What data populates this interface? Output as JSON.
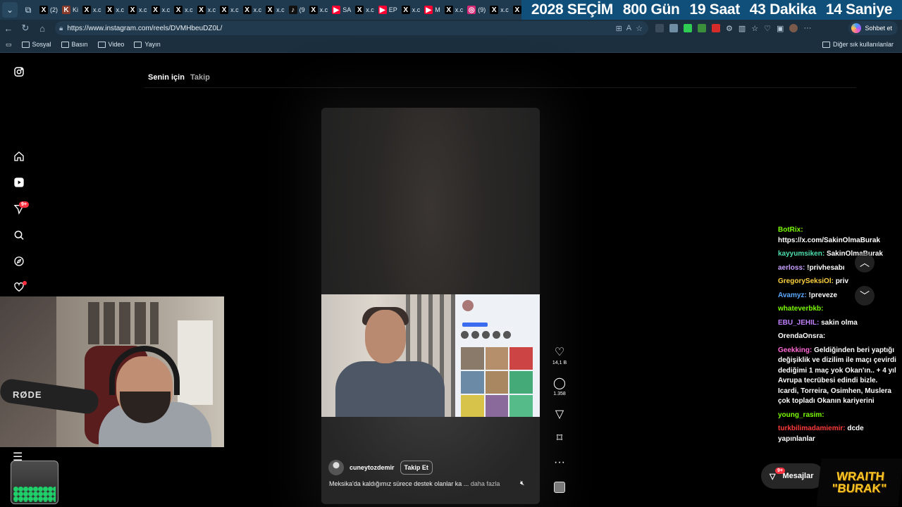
{
  "browser": {
    "tabs": [
      {
        "icon": "x-icon",
        "label": "(2)"
      },
      {
        "icon": "ki-icon",
        "label": "Ki"
      },
      {
        "icon": "x-icon",
        "label": "x.c"
      },
      {
        "icon": "x-icon",
        "label": "x.c"
      },
      {
        "icon": "x-icon",
        "label": "x.c"
      },
      {
        "icon": "x-icon",
        "label": "x.c"
      },
      {
        "icon": "x-icon",
        "label": "x.c"
      },
      {
        "icon": "x-icon",
        "label": "x.c"
      },
      {
        "icon": "x-icon",
        "label": "x.c"
      },
      {
        "icon": "x-icon",
        "label": "x.c"
      },
      {
        "icon": "x-icon",
        "label": "x.c"
      },
      {
        "icon": "tiktok-icon",
        "label": "(9"
      },
      {
        "icon": "x-icon",
        "label": "x.c"
      },
      {
        "icon": "youtube-icon",
        "label": "SA"
      },
      {
        "icon": "x-icon",
        "label": "x.c"
      },
      {
        "icon": "youtube-icon",
        "label": "EP"
      },
      {
        "icon": "x-icon",
        "label": "x.c"
      },
      {
        "icon": "youtube-icon",
        "label": "M"
      },
      {
        "icon": "x-icon",
        "label": "x.c"
      },
      {
        "icon": "instagram-icon",
        "label": "(9)"
      },
      {
        "icon": "x-icon",
        "label": "x.c"
      },
      {
        "icon": "x-icon",
        "label": "x.c"
      },
      {
        "icon": "x-icon",
        "label": "x.c"
      }
    ],
    "url": "https://www.instagram.com/reels/DVMHbeuDZ0L/",
    "chat_button": "Sohbet et",
    "bookmarks": [
      "Sosyal",
      "Basın",
      "Video",
      "Yayın"
    ],
    "bookmarks_other": "Diğer sık kullanılanlar"
  },
  "countdown": [
    "2028 SEÇİM",
    "800 Gün",
    "19 Saat",
    "43 Dakika",
    "14 Saniye"
  ],
  "instagram": {
    "nav_badge": "9+",
    "feed_tabs": {
      "active": "Senin için",
      "inactive": "Takip"
    },
    "reel": {
      "author": "cuneytozdemir",
      "follow": "Takip Et",
      "caption": "Meksika'da kaldığımız sürece destek olanlar ka ...",
      "more": "daha fazla",
      "likes": "14,1 B",
      "comments": "1.358"
    },
    "messages_label": "Mesajlar",
    "messages_badge": "9+"
  },
  "stream": {
    "mic_brand": "RØDE",
    "logo_line1": "WRAITH",
    "logo_line2": "\"BURAK\""
  },
  "chat": [
    {
      "user": "BotRix",
      "color": "#7cfc00",
      "text": "https://x.com/SakinOlmaBurak"
    },
    {
      "user": "kayyumsiken",
      "color": "#4fe0b0",
      "text": "SakinOlmaBurak"
    },
    {
      "user": "aerloss",
      "color": "#c8a0ff",
      "text": "!privhesabı"
    },
    {
      "user": "GregorySeksiOl",
      "color": "#ffd23f",
      "text": "priv"
    },
    {
      "user": "Avamyz",
      "color": "#5aa9ff",
      "text": "!preveze"
    },
    {
      "user": "whateverbkb",
      "color": "#7cfc00",
      "text": ""
    },
    {
      "user": "EBU_JEHIL",
      "color": "#c080ff",
      "text": "sakin olma"
    },
    {
      "user": "OrendaOnsra",
      "color": "#ffffff",
      "text": ""
    },
    {
      "user": "Geekking",
      "color": "#ff6ad5",
      "text": "Geldiğinden beri yaptığı değişiklik ve dizilim ile maçı çevirdi dediğimi 1 maç yok Okan'ın.. + 4 yıl Avrupa tecrübesi edindi bizle. Icardi, Torreira, Osimhen, Muslera çok topladı Okanın kariyerini"
    },
    {
      "user": "young_rasim",
      "color": "#7cfc00",
      "text": ""
    },
    {
      "user": "turkbilimadamiemir",
      "color": "#ff3b3b",
      "text": "dcde yapınlanlar"
    }
  ],
  "colors": {
    "accent_badge": "#ff3040",
    "countdown_bg": "#0f4f7a",
    "logo": "#f7c325"
  }
}
